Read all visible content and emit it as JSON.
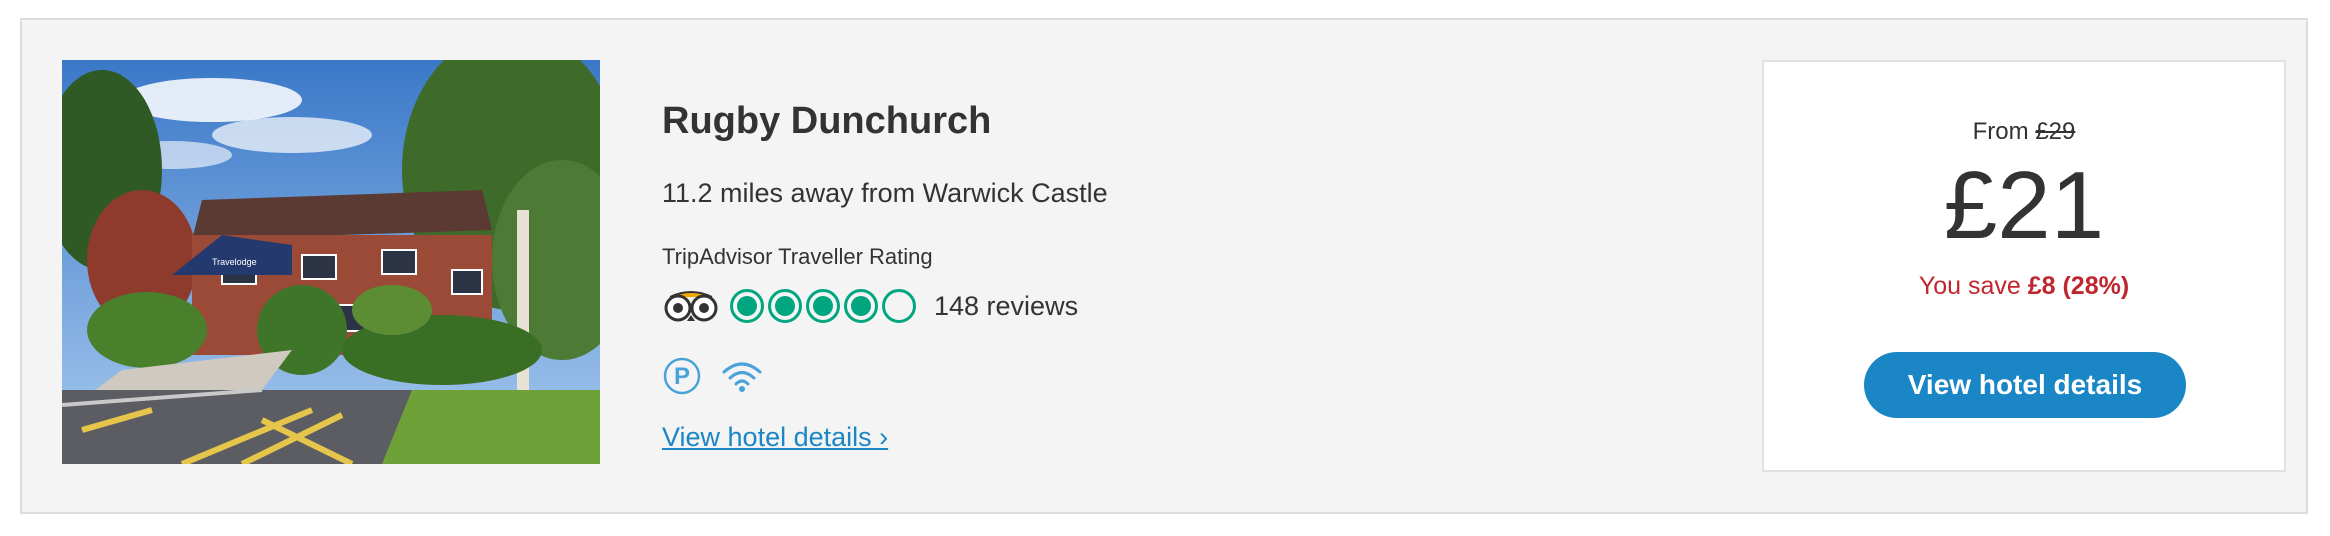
{
  "hotel": {
    "name": "Rugby Dunchurch",
    "distance": "11.2 miles away from Warwick Castle",
    "rating_label": "TripAdvisor Traveller Rating",
    "rating": 4,
    "rating_max": 5,
    "reviews": "148 reviews",
    "amenities": [
      "parking-icon",
      "wifi-icon"
    ],
    "details_link": "View hotel details ›",
    "photo_sign": "Travelodge"
  },
  "pricing": {
    "from_label": "From",
    "old_price": "£29",
    "price": "£21",
    "save_prefix": "You save",
    "save_amount": "£8 (28%)",
    "cta_label": "View hotel details"
  },
  "colors": {
    "accent": "#1a86c5",
    "rating_green": "#00a680",
    "save_red": "#c0262d",
    "card_bg": "#f4f4f4"
  }
}
